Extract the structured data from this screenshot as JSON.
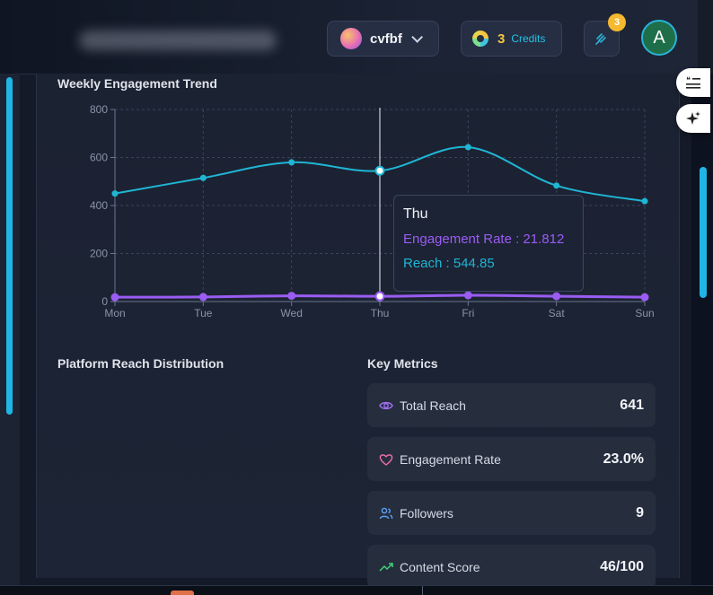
{
  "header": {
    "workspace_name": "cvfbf",
    "credits_count": "3",
    "credits_label": "Credits",
    "notification_count": "3",
    "user_initial": "A"
  },
  "engagement_trend": {
    "title": "Weekly Engagement Trend",
    "tooltip": {
      "day": "Thu",
      "engagement_text": "Engagement Rate : 21.812",
      "reach_text": "Reach : 544.85"
    }
  },
  "chart_data": {
    "type": "line",
    "title": "Weekly Engagement Trend",
    "categories": [
      "Mon",
      "Tue",
      "Wed",
      "Thu",
      "Fri",
      "Sat",
      "Sun"
    ],
    "series": [
      {
        "name": "Engagement Rate",
        "color": "#9a5cf2",
        "values": [
          18,
          19,
          24,
          21.812,
          26,
          22,
          18
        ]
      },
      {
        "name": "Reach",
        "color": "#1fb6d4",
        "values": [
          450,
          515,
          580,
          544.85,
          643,
          483,
          418
        ]
      }
    ],
    "y_ticks": [
      0,
      200,
      400,
      600,
      800
    ],
    "ylim": [
      0,
      800
    ],
    "grid": true,
    "highlighted_category": "Thu"
  },
  "platform_reach": {
    "title": "Platform Reach Distribution"
  },
  "key_metrics": {
    "title": "Key Metrics",
    "items": [
      {
        "label": "Total Reach",
        "value": "641",
        "icon": "eye-icon",
        "color": "#a070f5"
      },
      {
        "label": "Engagement Rate",
        "value": "23.0%",
        "icon": "heart-icon",
        "color": "#ef6fa6"
      },
      {
        "label": "Followers",
        "value": "9",
        "icon": "users-icon",
        "color": "#5ba2f5"
      },
      {
        "label": "Content Score",
        "value": "46/100",
        "icon": "trending-up-icon",
        "color": "#3fd37a"
      }
    ]
  }
}
